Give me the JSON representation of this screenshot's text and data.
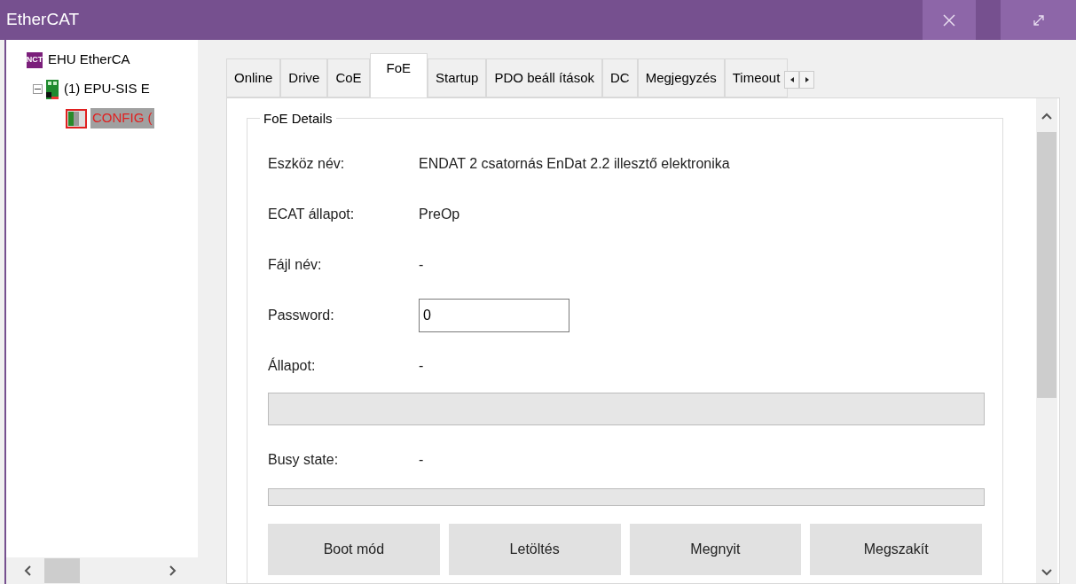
{
  "window": {
    "title": "EtherCAT"
  },
  "tree": [
    {
      "label": "EHU EtherCA",
      "kind": "master",
      "badge": "NCT",
      "selected": false,
      "children": [
        {
          "label": "(1) EPU-SIS E",
          "kind": "slave",
          "expanded": true,
          "selected": false,
          "children": [
            {
              "label": "CONFIG (",
              "kind": "module",
              "selected": true,
              "error": true
            }
          ]
        }
      ]
    }
  ],
  "tabs": [
    {
      "label": "Online",
      "selected": false
    },
    {
      "label": "Drive",
      "selected": false
    },
    {
      "label": "CoE",
      "selected": false
    },
    {
      "label": "FoE",
      "selected": true
    },
    {
      "label": "Startup",
      "selected": false
    },
    {
      "label": "PDO beáll ítások",
      "selected": false
    },
    {
      "label": "DC",
      "selected": false
    },
    {
      "label": "Megjegyzés",
      "selected": false
    },
    {
      "label": "Timeout",
      "selected": false
    }
  ],
  "group": {
    "title": "FoE Details",
    "rows": [
      {
        "kind": "text",
        "label": "Eszköz név:",
        "value": "ENDAT 2 csatornás EnDat 2.2 illesztő elektronika"
      },
      {
        "kind": "text",
        "label": "ECAT állapot:",
        "value": "PreOp"
      },
      {
        "kind": "text",
        "label": "Fájl név:",
        "value": "-"
      },
      {
        "kind": "input",
        "label": "Password:",
        "value": "0"
      },
      {
        "kind": "text",
        "label": "Állapot:",
        "value": "-"
      },
      {
        "kind": "progress",
        "level": 0
      },
      {
        "kind": "text",
        "label": "Busy state:",
        "value": "-"
      },
      {
        "kind": "progress",
        "level": 0
      }
    ],
    "buttons": [
      "Boot mód",
      "Letöltés",
      "Megnyit",
      "Megszakít"
    ]
  }
}
